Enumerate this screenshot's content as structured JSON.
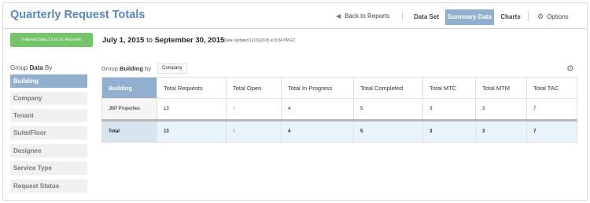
{
  "header": {
    "title": "Quarterly Request Totals",
    "back_label": "Back to Reports",
    "tabs": [
      {
        "label": "Data Set"
      },
      {
        "label": "Summary Data"
      },
      {
        "label": "Charts"
      }
    ],
    "active_tab": "Summary Data",
    "options_label": "Options"
  },
  "filter": {
    "badge": "Filtered Data 13 of 21 Records",
    "date_start": "July 1, 2015",
    "date_to": "to",
    "date_end": "September 30, 2015",
    "updated": "Data Updated 12/15/2015 at 8:34 PM ET"
  },
  "sidebar": {
    "label_prefix": "Group",
    "label_bold": "Data",
    "label_suffix": "By",
    "items": [
      {
        "label": "Building"
      },
      {
        "label": "Company"
      },
      {
        "label": "Tenant"
      },
      {
        "label": "Suite/Floor"
      },
      {
        "label": "Designee"
      },
      {
        "label": "Service Type"
      },
      {
        "label": "Request Status"
      }
    ],
    "active": "Building"
  },
  "grouping": {
    "label_prefix": "Group",
    "label_bold": "Building",
    "label_suffix": "by",
    "select_value": "Company"
  },
  "table": {
    "columns": [
      "Building",
      "Total Requests",
      "Total Open",
      "Total In Progress",
      "Total Completed",
      "Total MTC",
      "Total MTM",
      "Total TAC"
    ],
    "rows": [
      [
        "JBP Properties",
        "13",
        "0",
        "4",
        "5",
        "3",
        "3",
        "7"
      ]
    ],
    "total": [
      "Total",
      "13",
      "0",
      "4",
      "5",
      "3",
      "3",
      "7"
    ]
  },
  "colors": {
    "accent": "#92afd0",
    "title": "#5b86b8",
    "filter_badge": "#75c36a",
    "total_row": "#e9f3fa"
  },
  "icons": {
    "back": "arrow-left-icon",
    "options": "gear-icon",
    "table_settings": "gear-icon"
  }
}
